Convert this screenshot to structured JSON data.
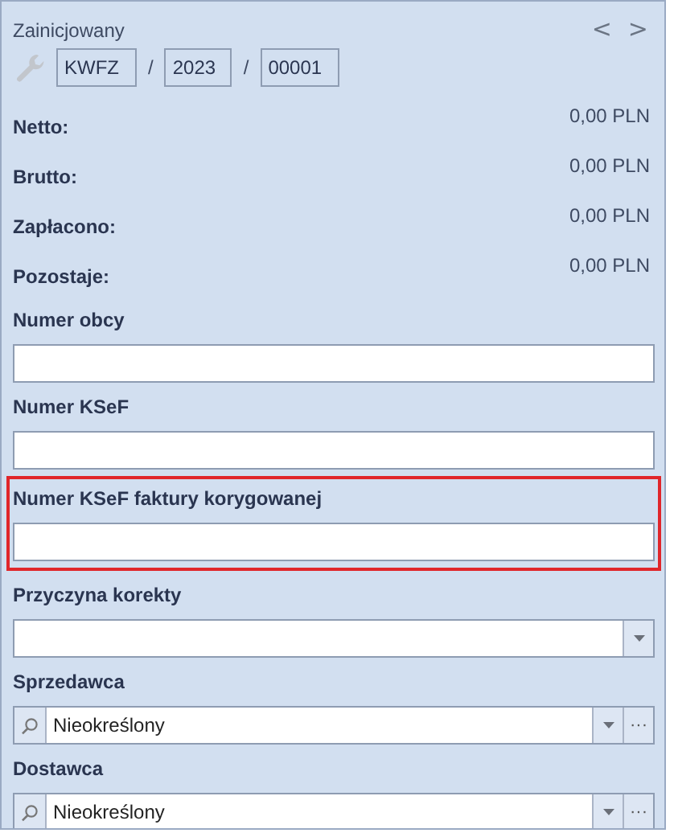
{
  "status": "Zainicjowany",
  "nav": {
    "prev": "<",
    "next": ">"
  },
  "document_number": {
    "parts": [
      "KWFZ",
      "2023",
      "00001"
    ],
    "separator": "/"
  },
  "amounts": [
    {
      "label": "Netto:",
      "value": "0,00 PLN"
    },
    {
      "label": "Brutto:",
      "value": "0,00 PLN"
    },
    {
      "label": "Zapłacono:",
      "value": "0,00 PLN"
    },
    {
      "label": "Pozostaje:",
      "value": "0,00 PLN"
    }
  ],
  "fields": [
    {
      "kind": "text",
      "label": "Numer obcy",
      "highlighted": false
    },
    {
      "kind": "text",
      "label": "Numer KSeF",
      "highlighted": false
    },
    {
      "kind": "text",
      "label": "Numer KSeF faktury korygowanej",
      "highlighted": true
    },
    {
      "kind": "dropdown",
      "label": "Przyczyna korekty",
      "highlighted": false
    },
    {
      "kind": "lookup",
      "label": "Sprzedawca",
      "value": "Nieokreślony",
      "more": "···",
      "highlighted": false
    },
    {
      "kind": "lookup",
      "label": "Dostawca",
      "value": "Nieokreślony",
      "more": "···",
      "highlighted": false
    }
  ]
}
